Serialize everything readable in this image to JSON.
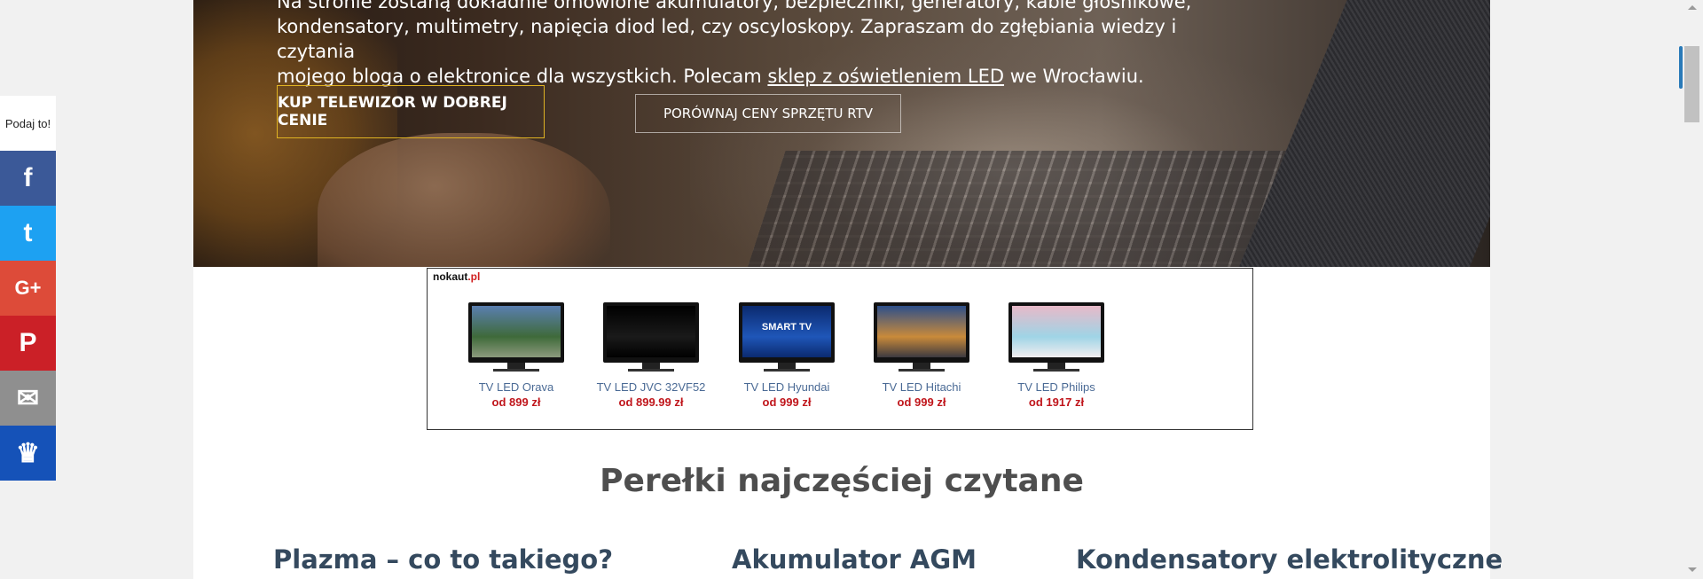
{
  "hero": {
    "line1": "Na stronie zostaną dokładnie omówione akumulatory, bezpieczniki, generatory, kable głośnikowe,",
    "line2": "kondensatory, multimetry, napięcia diod led, czy oscyloskopy. Zapraszam do zgłębiania wiedzy i czytania",
    "line3_before": "mojego bloga o elektronice dla wszystkich. Polecam ",
    "line3_link": "sklep z oświetleniem LED",
    "line3_after": " we Wrocławiu.",
    "primary_button": "KUP TELEWIZOR W DOBREJ CENIE",
    "secondary_button": "PORÓWNAJ CENY SPRZĘTU RTV"
  },
  "ad": {
    "brand": "nokaut",
    "tld": ".pl",
    "products": [
      {
        "name": "TV LED Orava",
        "price": "od 899 zł",
        "screen_colors": [
          "#5a7fb0",
          "#3f6a3a",
          "#8c9a7d"
        ]
      },
      {
        "name": "TV LED JVC 32VF52",
        "price": "od 899.99 zł",
        "screen_colors": [
          "#000000",
          "#1a1a1a",
          "#000000"
        ]
      },
      {
        "name": "TV LED Hyundai",
        "price": "od 999 zł",
        "screen_colors": [
          "#0b2a6f",
          "#1f56b8",
          "#0b2a6f"
        ],
        "screen_text": "SMART TV"
      },
      {
        "name": "TV LED Hitachi",
        "price": "od 999 zł",
        "screen_colors": [
          "#2d4f8a",
          "#c98a3a",
          "#3d3a40"
        ]
      },
      {
        "name": "TV LED Philips",
        "price": "od 1917 zł",
        "screen_colors": [
          "#e8b9c8",
          "#9fd4e6",
          "#f2eef0"
        ]
      }
    ]
  },
  "section": {
    "title": "Perełki najczęściej czytane"
  },
  "articles": [
    {
      "title": "Plazma – co to takiego?"
    },
    {
      "title": "Akumulator AGM"
    },
    {
      "title": "Kondensatory elektrolityczne"
    }
  ],
  "share": {
    "label": "Podaj to!",
    "buttons": [
      {
        "icon": "facebook-icon",
        "glyph": "f",
        "color": "#3b5998"
      },
      {
        "icon": "twitter-icon",
        "glyph": "t",
        "color": "#1da1f2"
      },
      {
        "icon": "google-plus-icon",
        "glyph": "G+",
        "color": "#dd4b39"
      },
      {
        "icon": "pinterest-icon",
        "glyph": "P",
        "color": "#cb2027"
      },
      {
        "icon": "email-icon",
        "glyph": "✉",
        "color": "#8f8f8f"
      },
      {
        "icon": "crown-icon",
        "glyph": "♛",
        "color": "#1552b8"
      }
    ]
  }
}
